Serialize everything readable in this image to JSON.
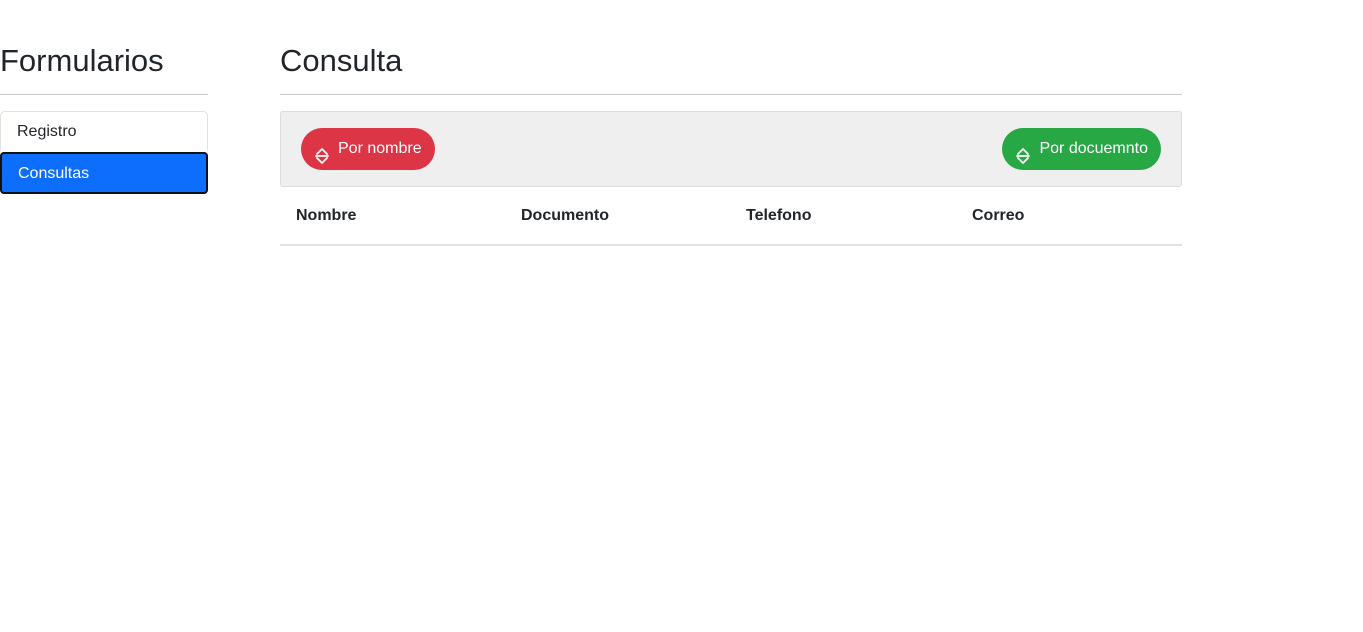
{
  "sidebar": {
    "title": "Formularios",
    "items": [
      {
        "label": "Registro",
        "active": false
      },
      {
        "label": "Consultas",
        "active": true
      }
    ]
  },
  "main": {
    "title": "Consulta",
    "toolbar": {
      "sort_by_name": {
        "label": "Por nombre",
        "icon": "sort-icon",
        "color": "#dc3545"
      },
      "sort_by_document": {
        "label": "Por docuemnto",
        "icon": "sort-icon",
        "color": "#28a745"
      }
    },
    "table": {
      "headers": [
        "Nombre",
        "Documento",
        "Telefono",
        "Correo"
      ],
      "rows": []
    }
  },
  "colors": {
    "accent": "#0d6efd",
    "danger": "#dc3545",
    "success": "#28a745"
  }
}
